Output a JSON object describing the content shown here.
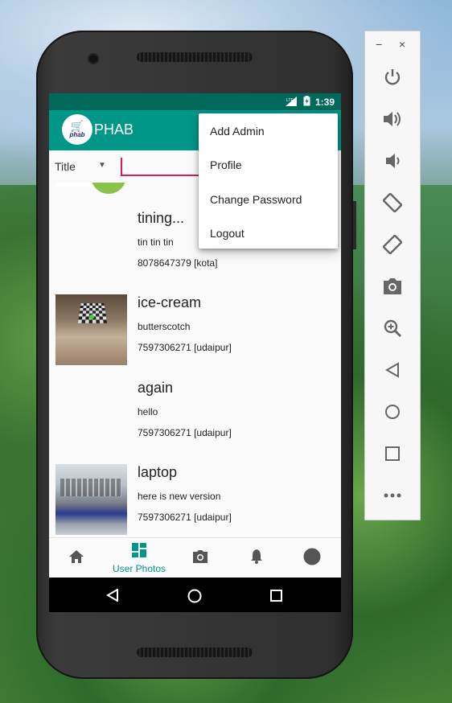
{
  "statusbar": {
    "network": "LTE",
    "time": "1:39"
  },
  "app": {
    "title": "PHAB",
    "logo_text": "phab"
  },
  "search": {
    "filter_selected": "Title",
    "value": ""
  },
  "menu": {
    "items": [
      "Add Admin",
      "Profile",
      "Change Password",
      "Logout"
    ]
  },
  "posts": [
    {
      "title": "tining...",
      "description": "tin tin tin",
      "phone": "8078647379 [kota]"
    },
    {
      "title": "ice-cream",
      "description": "butterscotch",
      "phone": "7597306271 [udaipur]"
    },
    {
      "title": "again",
      "description": "hello",
      "phone": "7597306271 [udaipur]"
    },
    {
      "title": "laptop",
      "description": "here is new version",
      "phone": "7597306271 [udaipur]"
    }
  ],
  "bottom_nav": {
    "active_label": "User Photos"
  },
  "colors": {
    "primary": "#009688",
    "primary_dark": "#00695c",
    "accent": "#d81b60"
  },
  "icons": [
    "home-icon",
    "dashboard-icon",
    "camera-icon",
    "bell-icon",
    "profile-circle-icon"
  ],
  "toolbar": {
    "minimize": "−",
    "close": "×"
  }
}
